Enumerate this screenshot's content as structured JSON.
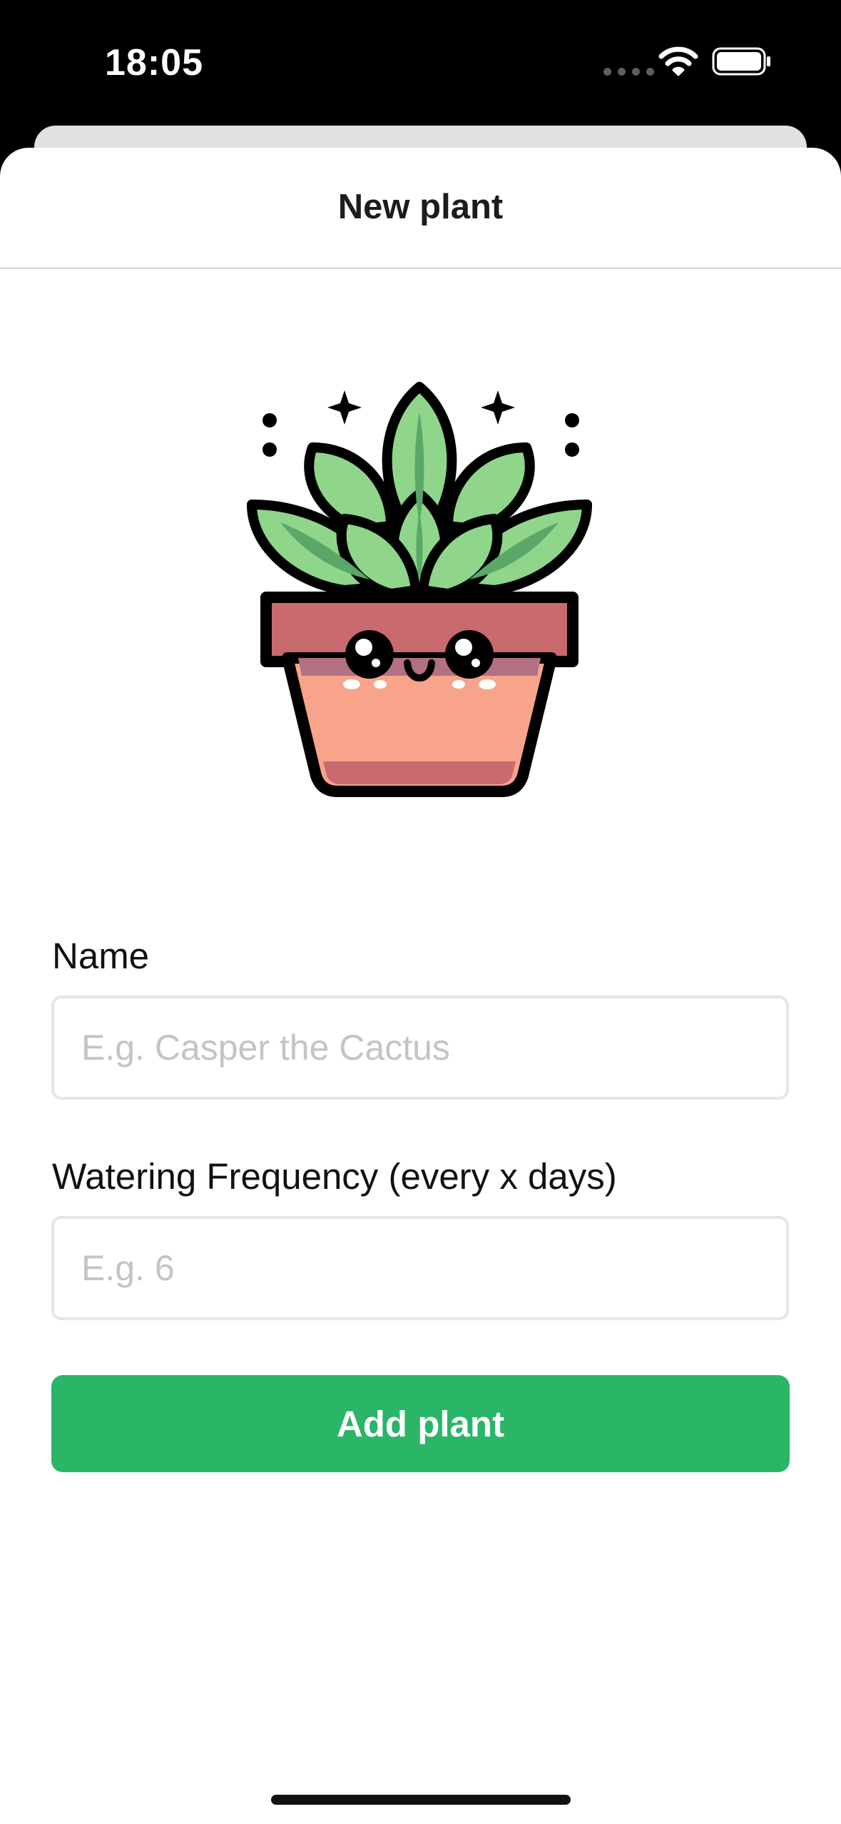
{
  "status_bar": {
    "time": "18:05",
    "icons": [
      "cellular-signal-icon",
      "wifi-icon",
      "battery-icon"
    ]
  },
  "sheet": {
    "title": "New plant"
  },
  "illustration": {
    "subject": "cute-potted-plant-icon"
  },
  "form": {
    "name_label": "Name",
    "name_placeholder": "E.g. Casper the Cactus",
    "name_value": "",
    "frequency_label": "Watering Frequency (every x days)",
    "frequency_placeholder": "E.g. 6",
    "frequency_value": "",
    "submit_label": "Add plant"
  },
  "colors": {
    "accent_green": "#2ab567",
    "leaf_green": "#8fd68a",
    "pot_salmon": "#f7a48a",
    "pot_rim": "#c96a6f"
  }
}
